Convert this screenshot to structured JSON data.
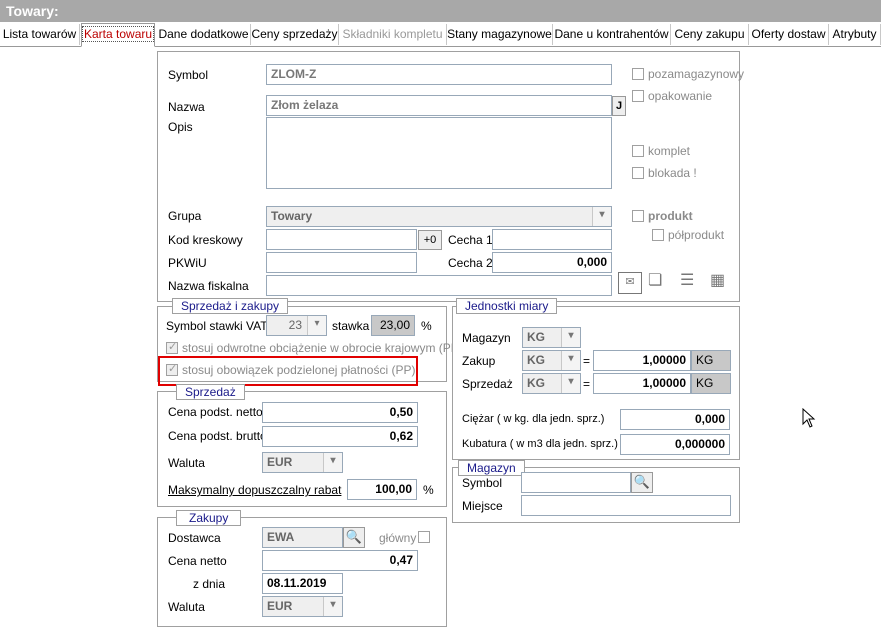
{
  "window": {
    "title": "Towary:"
  },
  "tabs": [
    {
      "label": "Lista towarów"
    },
    {
      "label": "Karta towaru"
    },
    {
      "label": "Dane dodatkowe"
    },
    {
      "label": "Ceny sprzedaży"
    },
    {
      "label": "Składniki kompletu"
    },
    {
      "label": "Stany magazynowe"
    },
    {
      "label": "Dane u kontrahentów"
    },
    {
      "label": "Ceny zakupu"
    },
    {
      "label": "Oferty dostaw"
    },
    {
      "label": "Atrybuty"
    }
  ],
  "main": {
    "symbol_label": "Symbol",
    "symbol_value": "ZLOM-Z",
    "nazwa_label": "Nazwa",
    "nazwa_value": "Złom żelaza",
    "j_button": "J",
    "opis_label": "Opis",
    "grupa_label": "Grupa",
    "grupa_value": "Towary",
    "kod_label": "Kod kreskowy",
    "kod_button": "+0",
    "cecha1_label": "Cecha 1",
    "cecha2_label": "Cecha 2",
    "cecha2_value": "0,000",
    "pkwiu_label": "PKWiU",
    "nazwa_fiskalna_label": "Nazwa fiskalna",
    "check_pozamagazynowy": "pozamagazynowy",
    "check_opakowanie": "opakowanie",
    "check_komplet": "komplet",
    "check_blokada": "blokada !",
    "check_produkt": "produkt",
    "check_polprodukt": "półprodukt"
  },
  "sprzedaz_zakupy": {
    "title": "Sprzedaż i zakupy",
    "vat_label": "Symbol stawki VAT",
    "vat_value": "23",
    "stawka_label": "stawka",
    "stawka_value": "23,00",
    "percent": "%",
    "odwrotne": "stosuj odwrotne obciążenie w obrocie krajowym (PRN)",
    "podzielona": "stosuj obowiązek podzielonej płatności (PP)"
  },
  "sprzedaz": {
    "title": "Sprzedaż",
    "netto_label": "Cena podst. netto",
    "netto_value": "0,50",
    "brutto_label": "Cena podst. brutto",
    "brutto_value": "0,62",
    "waluta_label": "Waluta",
    "waluta_value": "EUR",
    "rabat_label": "Maksymalny dopuszczalny rabat",
    "rabat_value": "100,00",
    "percent": "%"
  },
  "zakupy": {
    "title": "Zakupy",
    "dostawca_label": "Dostawca",
    "dostawca_value": "EWA",
    "glowny_label": "główny",
    "cena_label": "Cena netto",
    "cena_value": "0,47",
    "zdnia_label": "z dnia",
    "zdnia_value": "08.11.2019",
    "waluta_label": "Waluta",
    "waluta_value": "EUR"
  },
  "jednostki": {
    "title": "Jednostki miary",
    "magazyn_label": "Magazyn",
    "magazyn_value": "KG",
    "zakup_label": "Zakup",
    "zakup_value": "KG",
    "zakup_factor": "1,00000",
    "zakup_unit": "KG",
    "sprzedaz_label": "Sprzedaż",
    "sprzedaz_value": "KG",
    "sprzedaz_factor": "1,00000",
    "sprzedaz_unit": "KG",
    "equals": "=",
    "ciezar_label": "Ciężar ( w kg. dla jedn. sprz.)",
    "ciezar_value": "0,000",
    "kubatura_label": "Kubatura  ( w m3 dla jedn. sprz.)",
    "kubatura_value": "0,000000"
  },
  "magazyn": {
    "title": "Magazyn",
    "symbol_label": "Symbol",
    "miejsce_label": "Miejsce"
  }
}
